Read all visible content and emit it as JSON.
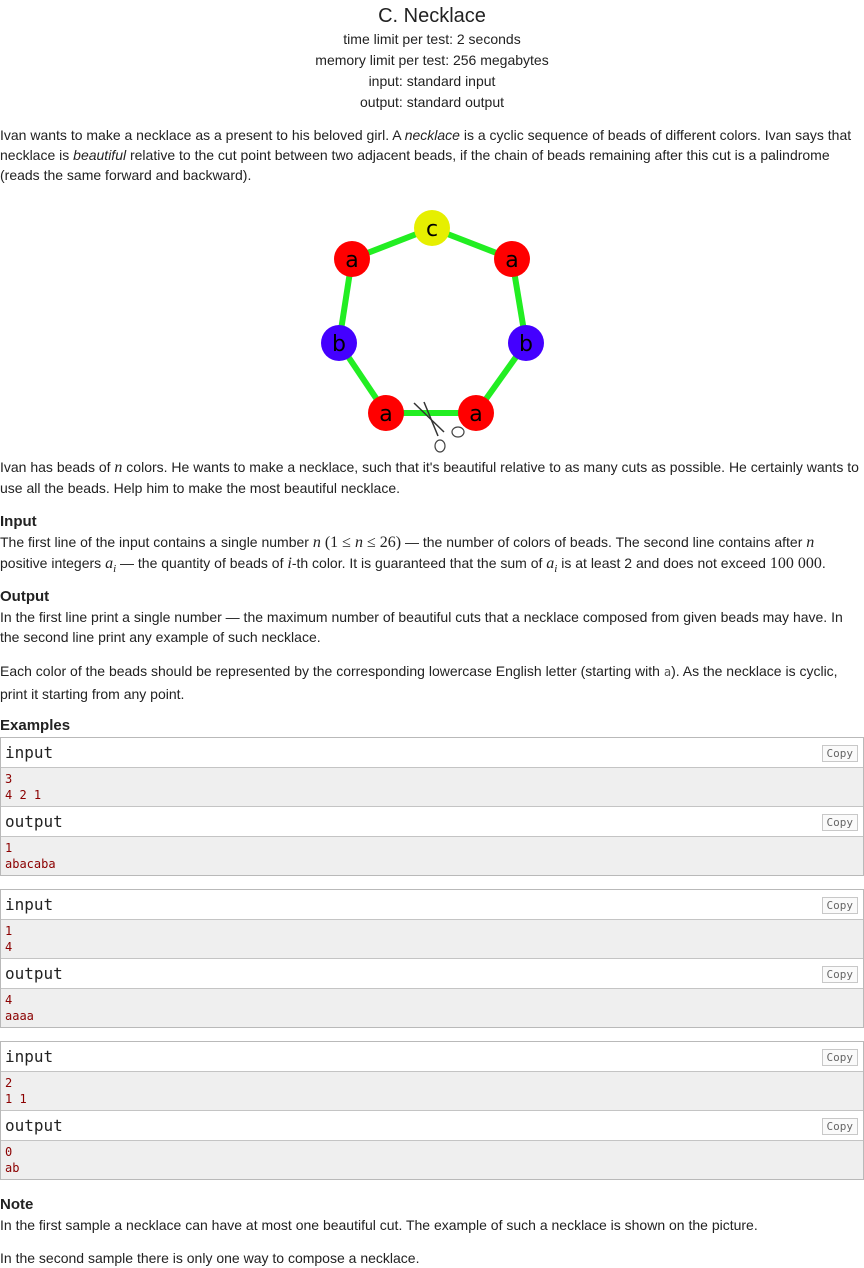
{
  "problem": {
    "title": "C. Necklace",
    "time_limit": "time limit per test: 2 seconds",
    "memory_limit": "memory limit per test: 256 megabytes",
    "input": "input: standard input",
    "output": "output: standard output"
  },
  "statement": {
    "p1_a": "Ivan wants to make a necklace as a present to his beloved girl. A ",
    "p1_necklace": "necklace",
    "p1_b": " is a cyclic sequence of beads of different colors. Ivan says that necklace is ",
    "p1_beautiful": "beautiful",
    "p1_c": " relative to the cut point between two adjacent beads, if the chain of beads remaining after this cut is a palindrome (reads the same forward and backward).",
    "p2_a": "Ivan has beads of ",
    "p2_n": "n",
    "p2_b": " colors. He wants to make a necklace, such that it's beautiful relative to as many cuts as possible. He certainly wants to use all the beads. Help him to make the most beautiful necklace."
  },
  "figure": {
    "beads": [
      "c",
      "a",
      "b",
      "a",
      "a",
      "b",
      "a"
    ],
    "colors": {
      "a": "#ff0000",
      "b": "#4400ff",
      "c": "#e6ef00",
      "link": "#22ee22"
    }
  },
  "input_section": {
    "title": "Input",
    "t1": "The first line of the input contains a single number ",
    "n": "n",
    "range_a": " (1 ≤ ",
    "range_n": "n",
    "range_b": " ≤ 26)",
    "t2": " — the number of colors of beads. The second line contains after ",
    "t2_n": "n",
    "t3": " positive integers ",
    "ai": "a",
    "ai_sub": "i",
    "t4": "  — the quantity of beads of ",
    "i": "i",
    "t5": "-th color. It is guaranteed that the sum of ",
    "ai2": "a",
    "ai2_sub": "i",
    "t6": " is at least 2 and does not exceed ",
    "limit": "100 000",
    "t7": "."
  },
  "output_section": {
    "title": "Output",
    "t1": "In the first line print a single number — the maximum number of beautiful cuts that a necklace composed from given beads may have. In the second line print any example of such necklace.",
    "t2_a": "Each color of the beads should be represented by the corresponding lowercase English letter (starting with ",
    "t2_code": "a",
    "t2_b": "). As the necklace is cyclic, print it starting from any point."
  },
  "examples": {
    "title": "Examples",
    "input_label": "input",
    "output_label": "output",
    "copy_label": "Copy",
    "tests": [
      {
        "input": [
          "3",
          "4 2 1"
        ],
        "output": [
          "1",
          "abacaba"
        ]
      },
      {
        "input": [
          "1",
          "4"
        ],
        "output": [
          "4",
          "aaaa"
        ]
      },
      {
        "input": [
          "2",
          "1 1"
        ],
        "output": [
          "0",
          "ab"
        ]
      }
    ]
  },
  "note": {
    "title": "Note",
    "p1": "In the first sample a necklace can have at most one beautiful cut. The example of such a necklace is shown on the picture.",
    "p2": "In the second sample there is only one way to compose a necklace."
  }
}
